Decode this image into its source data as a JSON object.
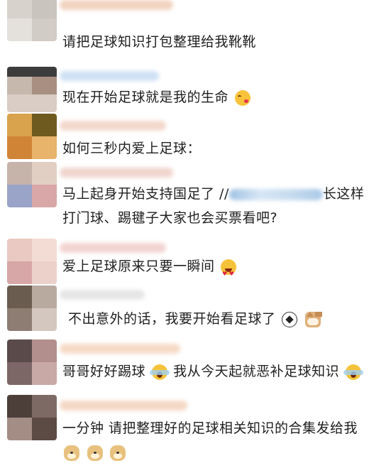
{
  "comments": [
    {
      "text": "请把足球知识打包整理给我靴靴",
      "avatar_colors": [
        "#d8d2cc",
        "#c9c4bd",
        "#e4e0dc",
        "#d2ccc6"
      ],
      "name_color": "#f1d3c0",
      "emojis": []
    },
    {
      "text": "现在开始足球就是我的生命",
      "avatar_colors": [
        "#3c3c3c",
        "#c7b8ae",
        "#a88f82",
        "#d9cdc5"
      ],
      "name_color": "#cfe1f4",
      "emojis": [
        "kiss-emoji"
      ]
    },
    {
      "text": "如何三秒内爱上足球：",
      "avatar_colors": [
        "#d9a24d",
        "#6e5a1e",
        "#d08536",
        "#e8b36a"
      ],
      "name_color": "#f3d8cc",
      "emojis": []
    },
    {
      "text_line1_start": "马上起身开始支持国足了 //",
      "text_line1_end": "长这样",
      "text_line2": "打门球、踢毽子大家也会买票看吧?",
      "avatar_colors": [
        "#c6b3aa",
        "#9aa4c8",
        "#d9a7a7",
        "#e2cfc4"
      ],
      "name_color": "#f0d6cf",
      "emojis": []
    },
    {
      "text": "爱上足球原来只要一瞬间",
      "avatar_colors": [
        "#e9c9c1",
        "#f3dcd4",
        "#d7a6a6",
        "#ecd1cb"
      ],
      "name_color": "#f2d4d2",
      "emojis": [
        "heart-eyes-emoji"
      ]
    },
    {
      "text": "不出意外的话，我要开始看足球了",
      "avatar_colors": [
        "#6b5c50",
        "#b9aaa0",
        "#8d7d72",
        "#d3c7bf"
      ],
      "name_color": "#e6e6e6",
      "emojis": [
        "soccer-ball-emoji",
        "cat-emoji"
      ]
    },
    {
      "text_part1": "哥哥好好踢球",
      "text_part2": "我从今天起就恶补足球知识",
      "avatar_colors": [
        "#5a4a4a",
        "#b28f8c",
        "#7d6766",
        "#c9a9a6"
      ],
      "name_color": "#f6dac6",
      "emojis": [
        "screaming-emoji",
        "screaming-emoji"
      ]
    },
    {
      "text_line1": "一分钟 请把整理好的足球相关知识的合集发给我",
      "avatar_colors": [
        "#4c3f3a",
        "#7e6a64",
        "#a38d85",
        "#5c4a45"
      ],
      "name_color": "#f4d8c4",
      "emojis": [
        "doge-emoji",
        "doge-emoji",
        "doge-emoji"
      ]
    }
  ]
}
